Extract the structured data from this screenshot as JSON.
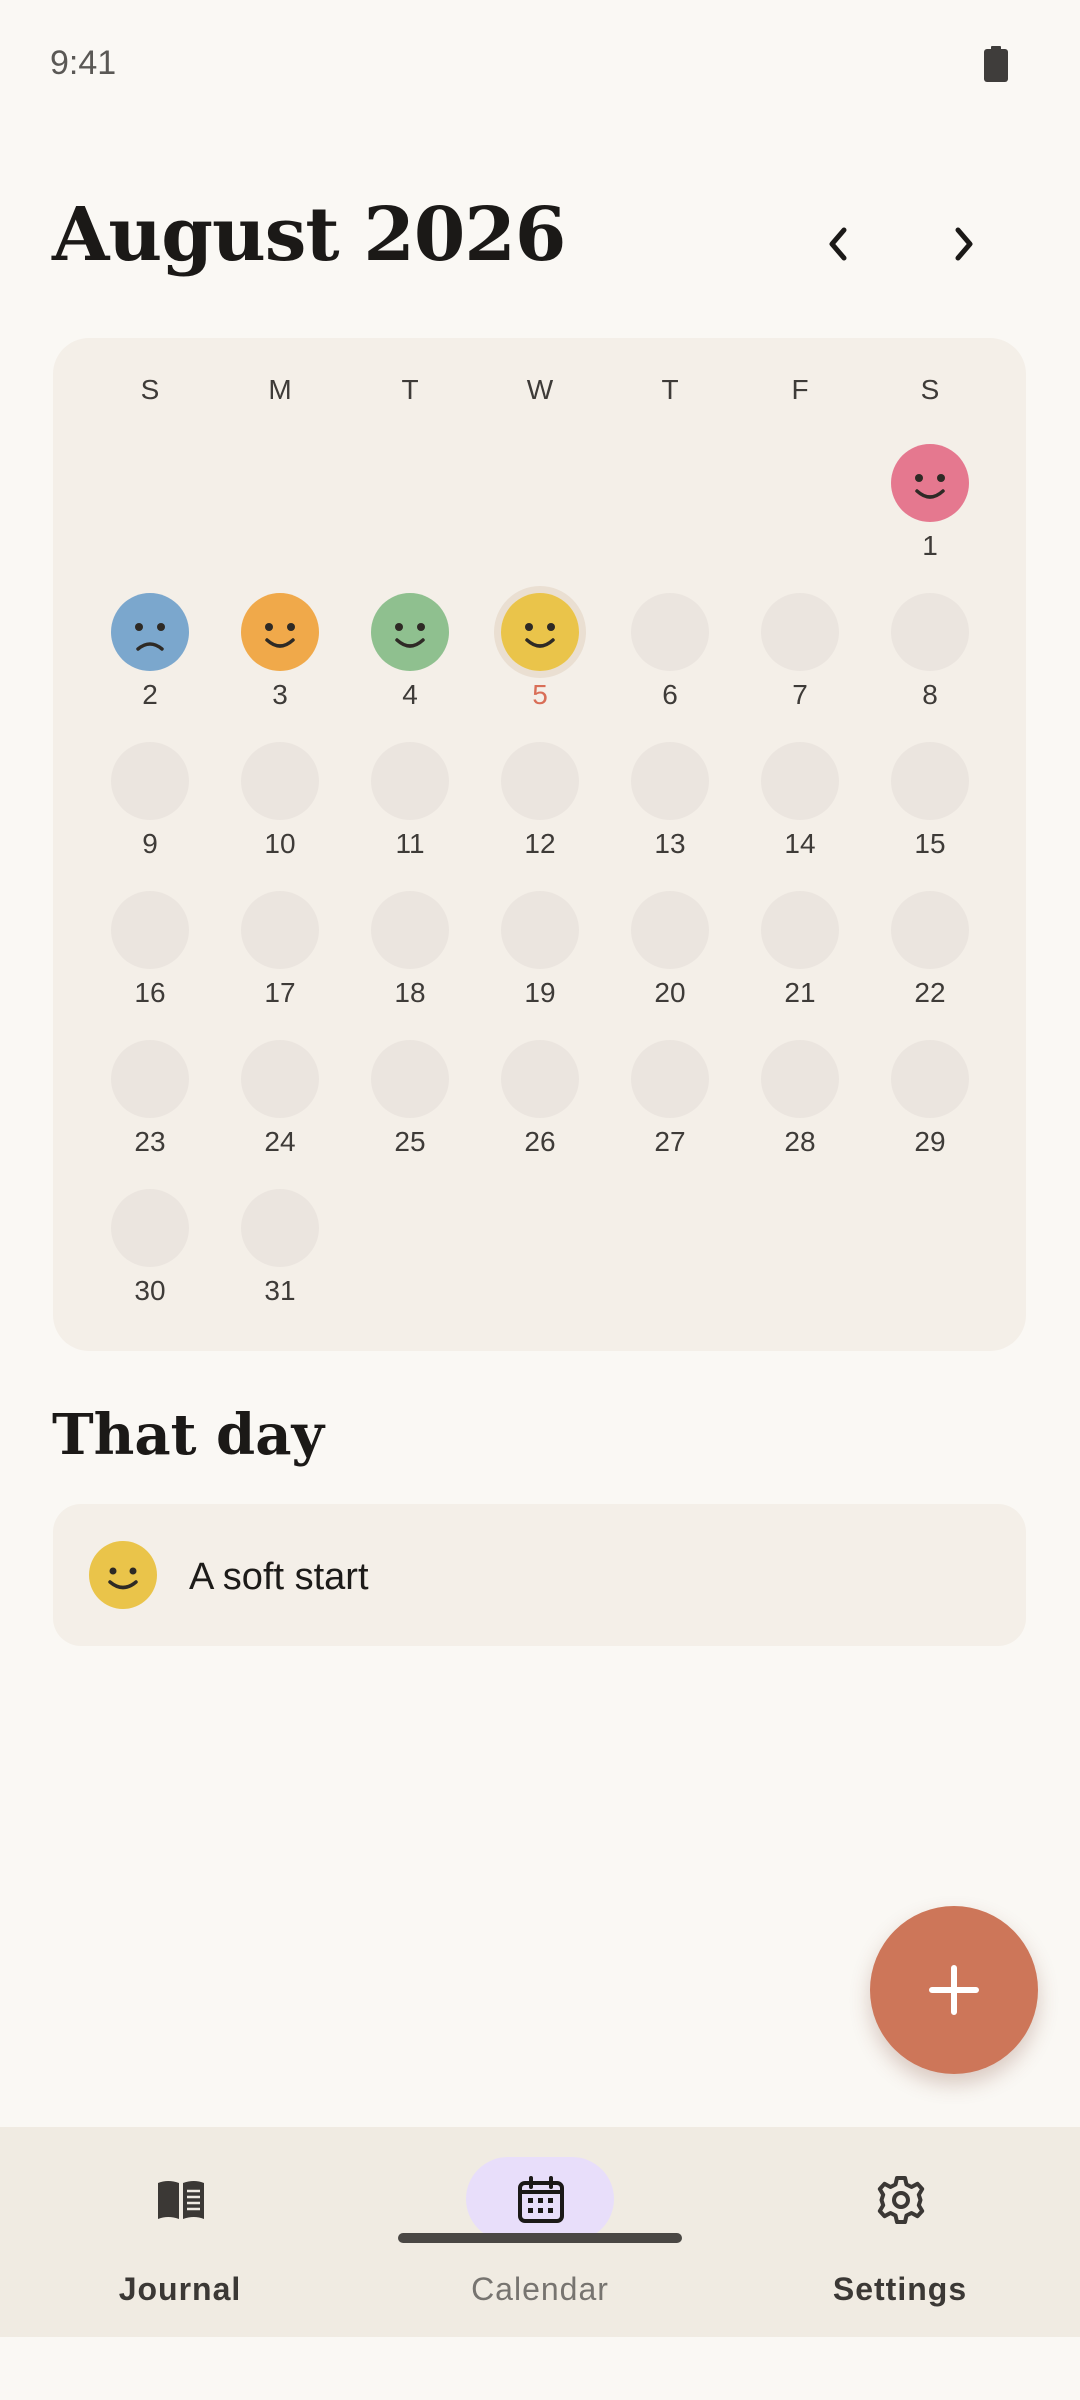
{
  "status_bar": {
    "time": "9:41"
  },
  "header": {
    "month_title": "August 2026"
  },
  "calendar": {
    "weekdays": [
      "S",
      "M",
      "T",
      "W",
      "T",
      "F",
      "S"
    ],
    "days": [
      {
        "num": "1",
        "mood": "happy",
        "color": "#e5788f"
      },
      {
        "num": "2",
        "mood": "sad",
        "color": "#7ba7cd"
      },
      {
        "num": "3",
        "mood": "happy",
        "color": "#f0a94a"
      },
      {
        "num": "4",
        "mood": "happy",
        "color": "#8fc08f"
      },
      {
        "num": "5",
        "mood": "happy",
        "color": "#eac44a",
        "today": true,
        "selected": true
      },
      {
        "num": "6"
      },
      {
        "num": "7"
      },
      {
        "num": "8"
      },
      {
        "num": "9"
      },
      {
        "num": "10"
      },
      {
        "num": "11"
      },
      {
        "num": "12"
      },
      {
        "num": "13"
      },
      {
        "num": "14"
      },
      {
        "num": "15"
      },
      {
        "num": "16"
      },
      {
        "num": "17"
      },
      {
        "num": "18"
      },
      {
        "num": "19"
      },
      {
        "num": "20"
      },
      {
        "num": "21"
      },
      {
        "num": "22"
      },
      {
        "num": "23"
      },
      {
        "num": "24"
      },
      {
        "num": "25"
      },
      {
        "num": "26"
      },
      {
        "num": "27"
      },
      {
        "num": "28"
      },
      {
        "num": "29"
      },
      {
        "num": "30"
      },
      {
        "num": "31"
      }
    ]
  },
  "that_day": {
    "title": "That day",
    "entry": {
      "title": "A soft start",
      "mood": "happy",
      "color": "#eac44a"
    }
  },
  "fab": {
    "icon": "plus-icon"
  },
  "bottom_nav": {
    "items": [
      {
        "label": "Journal",
        "icon": "book-icon"
      },
      {
        "label": "Calendar",
        "icon": "calendar-icon",
        "active": true
      },
      {
        "label": "Settings",
        "icon": "gear-icon"
      }
    ]
  },
  "colors": {
    "accent": "#cd7659",
    "today": "#d96e57",
    "card_bg": "#f4efe8",
    "empty_day": "#ebe5df",
    "active_nav_pill": "#e8defa"
  }
}
